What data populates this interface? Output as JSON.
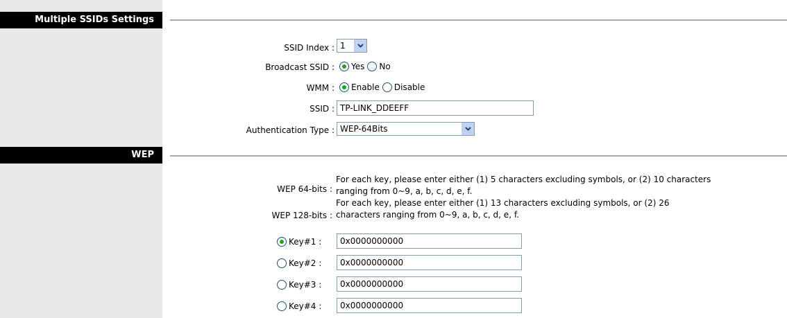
{
  "sections": {
    "multiple_ssids": "Multiple SSIDs Settings",
    "wep": "WEP"
  },
  "fields": {
    "ssid_index_label": "SSID Index :",
    "ssid_index_value": "1",
    "broadcast_label": "Broadcast SSID :",
    "broadcast_yes": "Yes",
    "broadcast_no": "No",
    "wmm_label": "WMM :",
    "wmm_enable": "Enable",
    "wmm_disable": "Disable",
    "ssid_label": "SSID :",
    "ssid_value": "TP-LINK_DDEEFF",
    "auth_label": "Authentication Type :",
    "auth_value": "WEP-64Bits"
  },
  "wep": {
    "wep64_label": "WEP 64-bits :",
    "wep64_note_1": "For each key, please enter either (1) 5 characters excluding symbols, or (2) 10 characters",
    "wep64_note_2": "ranging from 0~9, a, b, c, d, e, f.",
    "wep128_label": "WEP 128-bits :",
    "wep128_note_1": "For each key, please enter either (1) 13 characters excluding symbols, or (2) 26",
    "wep128_note_2": "characters ranging from 0~9, a, b, c, d, e, f.",
    "keys": [
      {
        "label": "Key#1 :",
        "value": "0x0000000000",
        "selected": true
      },
      {
        "label": "Key#2 :",
        "value": "0x0000000000",
        "selected": false
      },
      {
        "label": "Key#3 :",
        "value": "0x0000000000",
        "selected": false
      },
      {
        "label": "Key#4 :",
        "value": "0x0000000000",
        "selected": false
      }
    ]
  },
  "colors": {
    "header_bg": "#000000",
    "sidebar_bg": "#e8e8e8",
    "radio_dot": "#21a121",
    "dropdown_button": "#c1d2ee"
  }
}
